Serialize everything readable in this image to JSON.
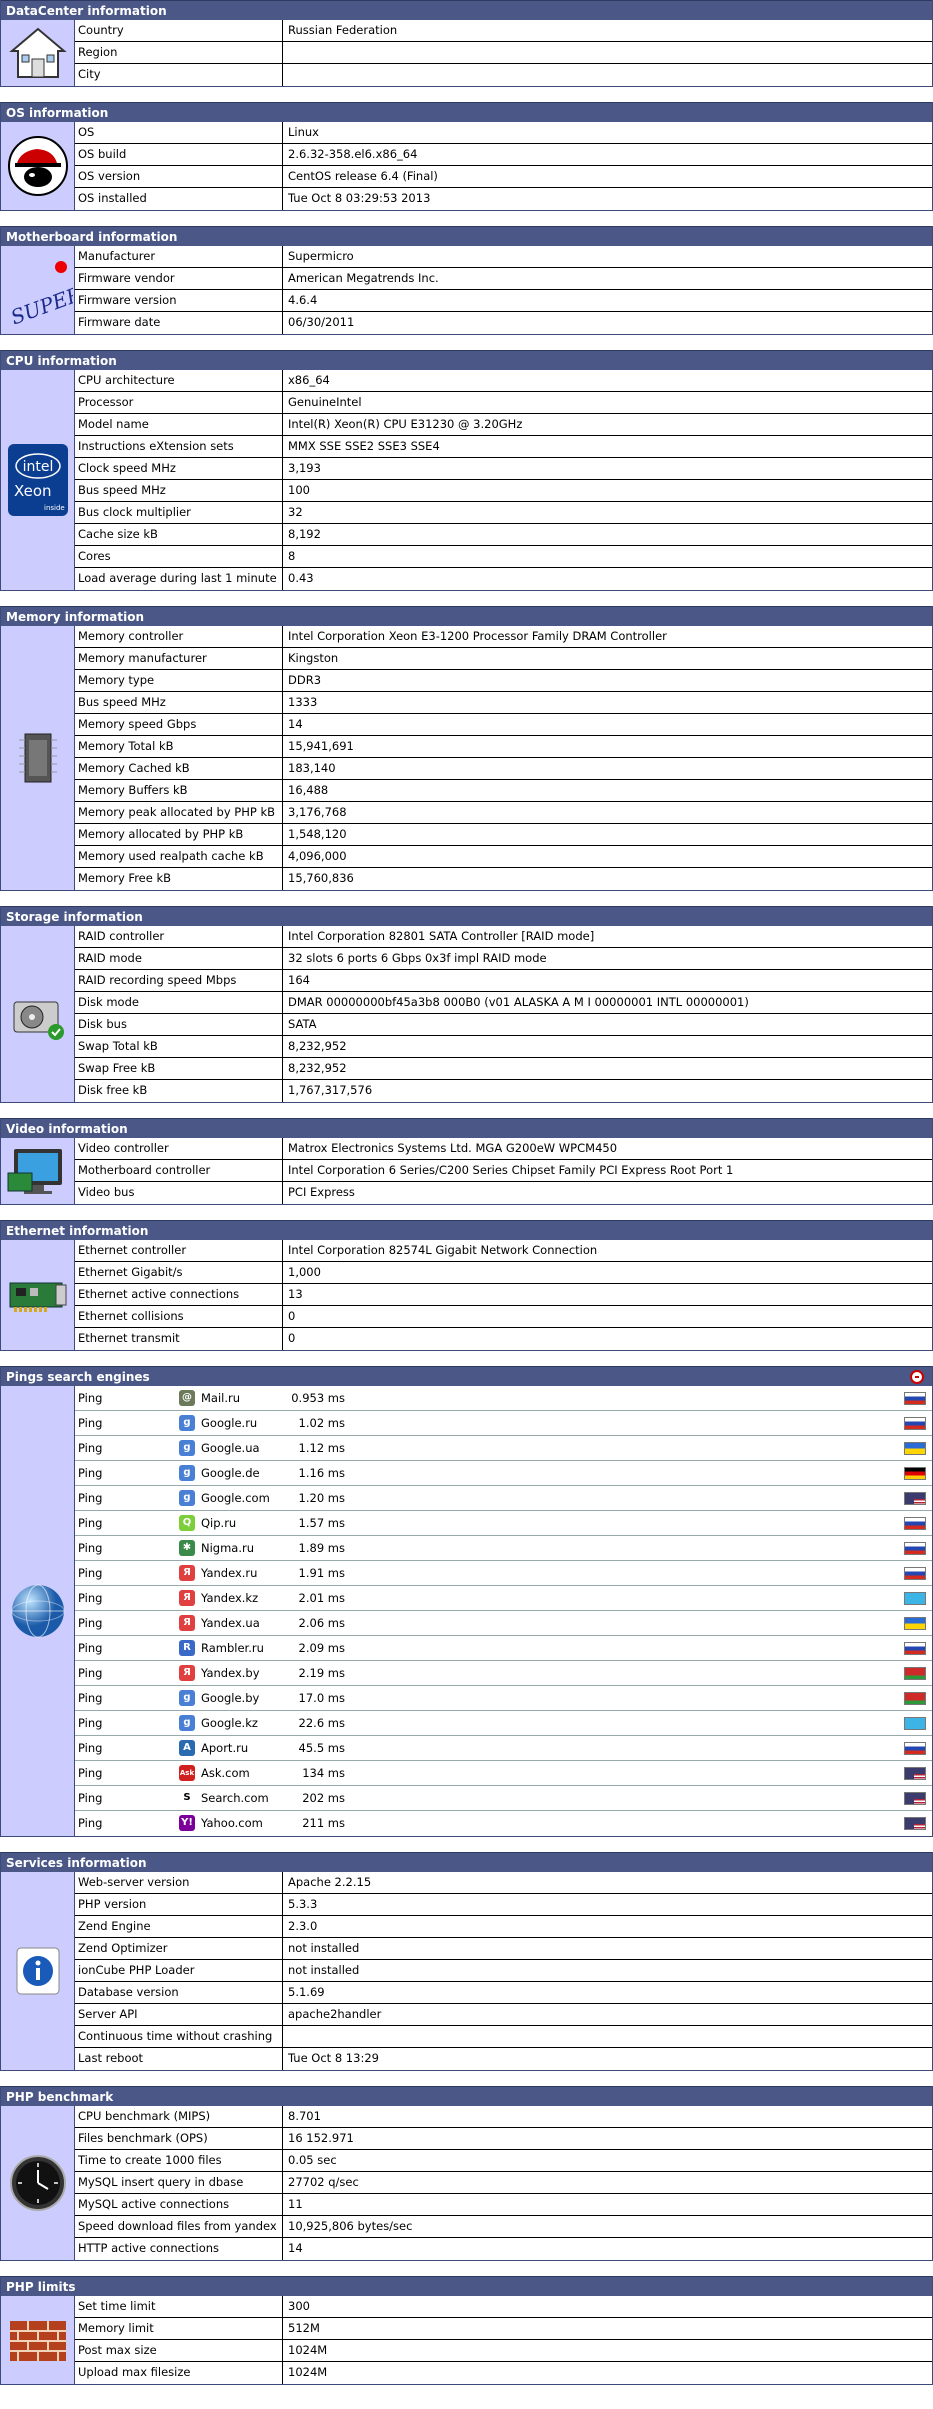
{
  "sections": {
    "datacenter": {
      "title": "DataCenter information",
      "rows": [
        [
          "Country",
          "Russian Federation"
        ],
        [
          "Region",
          ""
        ],
        [
          "City",
          ""
        ]
      ]
    },
    "os": {
      "title": "OS information",
      "rows": [
        [
          "OS",
          "Linux"
        ],
        [
          "OS build",
          "2.6.32-358.el6.x86_64"
        ],
        [
          "OS version",
          "CentOS release 6.4 (Final)"
        ],
        [
          "OS installed",
          "Tue Oct 8 03:29:53 2013"
        ]
      ]
    },
    "motherboard": {
      "title": "Motherboard information",
      "logo_text": "SUPER",
      "rows": [
        [
          "Manufacturer",
          "Supermicro"
        ],
        [
          "Firmware vendor",
          "American Megatrends Inc."
        ],
        [
          "Firmware version",
          "4.6.4"
        ],
        [
          "Firmware date",
          "06/30/2011"
        ]
      ]
    },
    "cpu": {
      "title": "CPU information",
      "logo_text": "intel",
      "logo_sub": "Xeon",
      "logo_inside": "inside",
      "rows": [
        [
          "CPU architecture",
          "x86_64"
        ],
        [
          "Processor",
          "GenuineIntel"
        ],
        [
          "Model name",
          "Intel(R) Xeon(R) CPU E31230 @ 3.20GHz"
        ],
        [
          "Instructions eXtension sets",
          "MMX SSE SSE2 SSE3 SSE4"
        ],
        [
          "Clock speed MHz",
          "3,193"
        ],
        [
          "Bus speed MHz",
          "100"
        ],
        [
          "Bus clock multiplier",
          "32"
        ],
        [
          "Cache size kB",
          "8,192"
        ],
        [
          "Cores",
          "8"
        ],
        [
          "Load average during last 1 minute",
          "0.43"
        ]
      ]
    },
    "memory": {
      "title": "Memory information",
      "rows": [
        [
          "Memory controller",
          "Intel Corporation Xeon E3-1200 Processor Family DRAM Controller"
        ],
        [
          "Memory manufacturer",
          "Kingston"
        ],
        [
          "Memory type",
          "DDR3"
        ],
        [
          "Bus speed MHz",
          "1333"
        ],
        [
          "Memory speed Gbps",
          "14"
        ],
        [
          "Memory Total kB",
          "15,941,691"
        ],
        [
          "Memory Cached kB",
          "183,140"
        ],
        [
          "Memory Buffers kB",
          "16,488"
        ],
        [
          "Memory peak allocated by PHP kB",
          "3,176,768"
        ],
        [
          "Memory allocated by PHP kB",
          "1,548,120"
        ],
        [
          "Memory used realpath cache kB",
          "4,096,000"
        ],
        [
          "Memory Free kB",
          "15,760,836"
        ]
      ]
    },
    "storage": {
      "title": "Storage information",
      "rows": [
        [
          "RAID controller",
          "Intel Corporation 82801 SATA Controller [RAID mode]"
        ],
        [
          "RAID mode",
          "32 slots 6 ports 6 Gbps 0x3f impl RAID mode"
        ],
        [
          "RAID recording speed Mbps",
          "164"
        ],
        [
          "Disk mode",
          "DMAR 00000000bf45a3b8 000B0 (v01 ALASKA A M I 00000001 INTL 00000001)"
        ],
        [
          "Disk bus",
          "SATA"
        ],
        [
          "Swap Total kB",
          "8,232,952"
        ],
        [
          "Swap Free kB",
          "8,232,952"
        ],
        [
          "Disk free kB",
          "1,767,317,576"
        ]
      ]
    },
    "video": {
      "title": "Video information",
      "rows": [
        [
          "Video controller",
          "Matrox Electronics Systems Ltd. MGA G200eW WPCM450"
        ],
        [
          "Motherboard controller",
          "Intel Corporation 6 Series/C200 Series Chipset Family PCI Express Root Port 1"
        ],
        [
          "Video bus",
          "PCI Express"
        ]
      ]
    },
    "ethernet": {
      "title": "Ethernet information",
      "rows": [
        [
          "Ethernet controller",
          "Intel Corporation 82574L Gigabit Network Connection"
        ],
        [
          "Ethernet Gigabit/s",
          "1,000"
        ],
        [
          "Ethernet active connections",
          "13"
        ],
        [
          "Ethernet collisions",
          "0"
        ],
        [
          "Ethernet transmit",
          "0"
        ]
      ]
    },
    "pings": {
      "title": "Pings search engines",
      "label": "Ping",
      "rows": [
        {
          "name": "Mail.ru",
          "ms": "0.953 ms",
          "icon": "mailru-icon",
          "icon_color": "#6b7a5a",
          "glyph": "@",
          "flag": "ru"
        },
        {
          "name": "Google.ru",
          "ms": "1.02 ms",
          "icon": "google-icon",
          "icon_color": "#4a7fd6",
          "glyph": "g",
          "flag": "ru"
        },
        {
          "name": "Google.ua",
          "ms": "1.12 ms",
          "icon": "google-icon",
          "icon_color": "#4a7fd6",
          "glyph": "g",
          "flag": "ua"
        },
        {
          "name": "Google.de",
          "ms": "1.16 ms",
          "icon": "google-icon",
          "icon_color": "#4a7fd6",
          "glyph": "g",
          "flag": "de"
        },
        {
          "name": "Google.com",
          "ms": "1.20 ms",
          "icon": "google-icon",
          "icon_color": "#4a7fd6",
          "glyph": "g",
          "flag": "us"
        },
        {
          "name": "Qip.ru",
          "ms": "1.57 ms",
          "icon": "qip-icon",
          "icon_color": "#7ccf3a",
          "glyph": "Q",
          "flag": "ru"
        },
        {
          "name": "Nigma.ru",
          "ms": "1.89 ms",
          "icon": "nigma-icon",
          "icon_color": "#3a8a4a",
          "glyph": "✱",
          "flag": "ru"
        },
        {
          "name": "Yandex.ru",
          "ms": "1.91 ms",
          "icon": "yandex-icon",
          "icon_color": "#e04040",
          "glyph": "Я",
          "flag": "ru"
        },
        {
          "name": "Yandex.kz",
          "ms": "2.01 ms",
          "icon": "yandex-icon",
          "icon_color": "#e04040",
          "glyph": "Я",
          "flag": "kz"
        },
        {
          "name": "Yandex.ua",
          "ms": "2.06 ms",
          "icon": "yandex-icon",
          "icon_color": "#e04040",
          "glyph": "Я",
          "flag": "ua"
        },
        {
          "name": "Rambler.ru",
          "ms": "2.09 ms",
          "icon": "rambler-icon",
          "icon_color": "#3a6ac8",
          "glyph": "R",
          "flag": "ru"
        },
        {
          "name": "Yandex.by",
          "ms": "2.19 ms",
          "icon": "yandex-icon",
          "icon_color": "#e04040",
          "glyph": "Я",
          "flag": "by"
        },
        {
          "name": "Google.by",
          "ms": "17.0 ms",
          "icon": "google-icon",
          "icon_color": "#4a7fd6",
          "glyph": "g",
          "flag": "by"
        },
        {
          "name": "Google.kz",
          "ms": "22.6 ms",
          "icon": "google-icon",
          "icon_color": "#4a7fd6",
          "glyph": "g",
          "flag": "kz"
        },
        {
          "name": "Aport.ru",
          "ms": "45.5 ms",
          "icon": "aport-icon",
          "icon_color": "#2a6ab0",
          "glyph": "A",
          "flag": "ru"
        },
        {
          "name": "Ask.com",
          "ms": "134 ms",
          "icon": "ask-icon",
          "icon_color": "#d02020",
          "glyph": "Ask",
          "flag": "us"
        },
        {
          "name": "Search.com",
          "ms": "202 ms",
          "icon": "search-com-icon",
          "icon_color": "#ffffff",
          "glyph": "S",
          "flag": "us"
        },
        {
          "name": "Yahoo.com",
          "ms": "211 ms",
          "icon": "yahoo-icon",
          "icon_color": "#7b0099",
          "glyph": "Y!",
          "flag": "us"
        }
      ]
    },
    "services": {
      "title": "Services information",
      "rows": [
        [
          "Web-server version",
          "Apache 2.2.15"
        ],
        [
          "PHP version",
          "5.3.3"
        ],
        [
          "Zend Engine",
          "2.3.0"
        ],
        [
          "Zend Optimizer",
          "not installed"
        ],
        [
          "ionCube PHP Loader",
          "not installed"
        ],
        [
          "Database version",
          "5.1.69"
        ],
        [
          "Server API",
          "apache2handler"
        ],
        [
          "Continuous time without crashing",
          ""
        ],
        [
          "Last reboot",
          "Tue Oct 8 13:29"
        ]
      ]
    },
    "benchmark": {
      "title": "PHP benchmark",
      "rows": [
        [
          "CPU benchmark (MIPS)",
          "8.701"
        ],
        [
          "Files benchmark (OPS)",
          "16 152.971"
        ],
        [
          "Time to create 1000 files",
          "0.05 sec"
        ],
        [
          "MySQL insert query in dbase",
          "27702 q/sec"
        ],
        [
          "MySQL active connections",
          "11"
        ],
        [
          "Speed download files from yandex",
          "10,925,806 bytes/sec"
        ],
        [
          "HTTP active connections",
          "14"
        ]
      ]
    },
    "limits": {
      "title": "PHP limits",
      "rows": [
        [
          "Set time limit",
          "300"
        ],
        [
          "Memory limit",
          "512M"
        ],
        [
          "Post max size",
          "1024M"
        ],
        [
          "Upload max filesize",
          "1024M"
        ]
      ]
    }
  }
}
